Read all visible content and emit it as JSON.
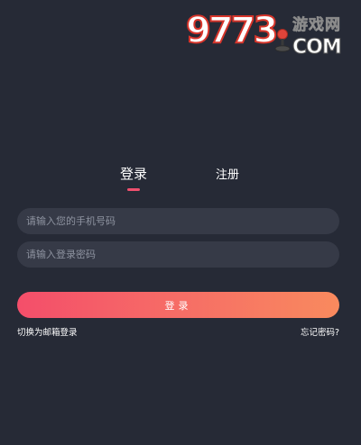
{
  "watermark": {
    "digits": "9773",
    "site_name": "游戏网",
    "domain": "COM"
  },
  "tabs": {
    "login_label": "登录",
    "register_label": "注册",
    "active": "login"
  },
  "form": {
    "phone_placeholder": "请输入您的手机号码",
    "password_placeholder": "请输入登录密码",
    "submit_label": "登录"
  },
  "links": {
    "email_login": "切换为邮箱登录",
    "forgot_password": "忘记密码?"
  },
  "colors": {
    "background": "#262a36",
    "input_background": "#363a47",
    "accent_start": "#f44e6a",
    "accent_end": "#f98a5e",
    "tab_indicator": "#f0506e"
  }
}
